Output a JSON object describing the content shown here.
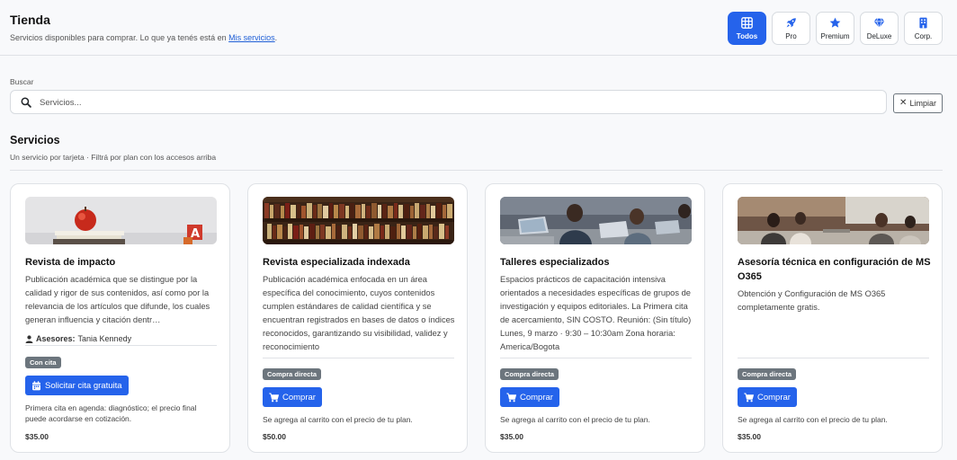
{
  "header": {
    "title": "Tienda",
    "subtitle_prefix": "Servicios disponibles para comprar. Lo que ya tenés está en ",
    "subtitle_link": "Mis servicios",
    "subtitle_suffix": ".",
    "plans": [
      {
        "label": "Todos",
        "icon": "grid-icon",
        "active": true
      },
      {
        "label": "Pro",
        "icon": "rocket-icon",
        "active": false
      },
      {
        "label": "Premium",
        "icon": "star-icon",
        "active": false
      },
      {
        "label": "DeLuxe",
        "icon": "diamond-icon",
        "active": false
      },
      {
        "label": "Corp.",
        "icon": "building-icon",
        "active": false
      }
    ]
  },
  "search": {
    "label": "Buscar",
    "placeholder": "Servicios...",
    "value": "",
    "clear_label": "Limpiar"
  },
  "section": {
    "title": "Servicios",
    "subtitle": "Un servicio por tarjeta · Filtrá por plan con los accesos arriba"
  },
  "colors": {
    "accent": "#2563eb",
    "badge": "#6c757d"
  },
  "cards": [
    {
      "title": "Revista de impacto",
      "description": "Publicación académica que se distingue por la calidad y rigor de sus contenidos, así como por la relevancia de los artículos que difunde, los cuales generan influencia y citación dentr…",
      "asesor_label": "Asesores:",
      "asesor_name": "Tania Kennedy",
      "badge": "Con cita",
      "button": "Solicitar cita gratuita",
      "button_icon": "calendar-icon",
      "note": "Primera cita en agenda: diagnóstico; el precio final puede acordarse en cotización.",
      "price": "$35.00"
    },
    {
      "title": "Revista especializada indexada",
      "description": "Publicación académica enfocada en un área específica del conocimiento, cuyos contenidos cumplen estándares de calidad científica y se encuentran registrados en bases de datos o índices reconocidos, garantizando su visibilidad, validez y reconocimiento",
      "badge": "Compra directa",
      "button": "Comprar",
      "button_icon": "cart-icon",
      "note": "Se agrega al carrito con el precio de tu plan.",
      "price": "$50.00"
    },
    {
      "title": "Talleres especializados",
      "description": "Espacios prácticos de capacitación intensiva orientados a necesidades específicas de grupos de investigación y equipos editoriales. La Primera cita de acercamiento, SIN COSTO. Reunión: (Sin título) Lunes, 9 marzo · 9:30 – 10:30am Zona horaria: America/Bogota",
      "badge": "Compra directa",
      "button": "Comprar",
      "button_icon": "cart-icon",
      "note": "Se agrega al carrito con el precio de tu plan.",
      "price": "$35.00"
    },
    {
      "title": "Asesoría técnica en configuración de MS O365",
      "description": "Obtención y Configuración de MS O365 completamente gratis.",
      "badge": "Compra directa",
      "button": "Comprar",
      "button_icon": "cart-icon",
      "note": "Se agrega al carrito con el precio de tu plan.",
      "price": "$35.00"
    }
  ]
}
